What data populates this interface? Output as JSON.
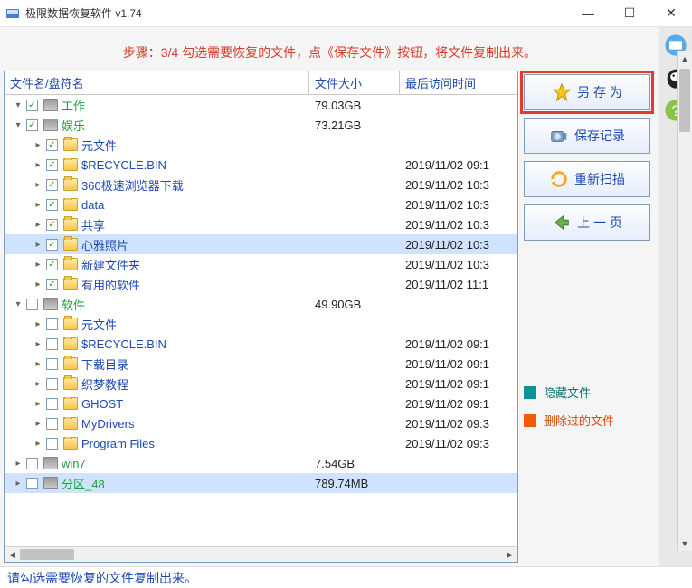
{
  "window": {
    "title": "极限数据恢复软件 v1.74"
  },
  "step_instruction": "步骤：3/4 勾选需要恢复的文件，点《保存文件》按钮，将文件复制出来。",
  "columns": {
    "name": "文件名/盘符名",
    "size": "文件大小",
    "time": "最后访问时间"
  },
  "rows": [
    {
      "depth": 0,
      "expander": "expanded",
      "checked": true,
      "icon": "drive",
      "label": "工作",
      "label_style": "green",
      "size": "79.03GB",
      "time": ""
    },
    {
      "depth": 0,
      "expander": "expanded",
      "checked": true,
      "icon": "drive",
      "label": "娱乐",
      "label_style": "green",
      "size": "73.21GB",
      "time": ""
    },
    {
      "depth": 1,
      "expander": "collapsed",
      "checked": true,
      "icon": "folder",
      "label": "元文件",
      "label_style": "blue",
      "size": "",
      "time": ""
    },
    {
      "depth": 1,
      "expander": "collapsed",
      "checked": true,
      "icon": "folder",
      "label": "$RECYCLE.BIN",
      "label_style": "blue",
      "size": "",
      "time": "2019/11/02 09:1"
    },
    {
      "depth": 1,
      "expander": "collapsed",
      "checked": true,
      "icon": "folder",
      "label": "360极速浏览器下载",
      "label_style": "blue",
      "size": "",
      "time": "2019/11/02 10:3"
    },
    {
      "depth": 1,
      "expander": "collapsed",
      "checked": true,
      "icon": "folder",
      "label": "data",
      "label_style": "blue",
      "size": "",
      "time": "2019/11/02 10:3"
    },
    {
      "depth": 1,
      "expander": "collapsed",
      "checked": true,
      "icon": "folder",
      "label": "共享",
      "label_style": "blue",
      "size": "",
      "time": "2019/11/02 10:3"
    },
    {
      "depth": 1,
      "expander": "collapsed",
      "checked": true,
      "icon": "folder",
      "label": "心雅照片",
      "label_style": "blue",
      "size": "",
      "time": "2019/11/02 10:3",
      "selected": true
    },
    {
      "depth": 1,
      "expander": "collapsed",
      "checked": true,
      "icon": "folder",
      "label": "新建文件夹",
      "label_style": "blue",
      "size": "",
      "time": "2019/11/02 10:3"
    },
    {
      "depth": 1,
      "expander": "collapsed",
      "checked": true,
      "icon": "folder",
      "label": "有用的软件",
      "label_style": "blue",
      "size": "",
      "time": "2019/11/02 11:1"
    },
    {
      "depth": 0,
      "expander": "expanded",
      "checked": false,
      "icon": "drive",
      "label": "软件",
      "label_style": "green",
      "size": "49.90GB",
      "time": ""
    },
    {
      "depth": 1,
      "expander": "collapsed",
      "checked": false,
      "icon": "folder",
      "label": "元文件",
      "label_style": "blue",
      "size": "",
      "time": ""
    },
    {
      "depth": 1,
      "expander": "collapsed",
      "checked": false,
      "icon": "folder",
      "label": "$RECYCLE.BIN",
      "label_style": "blue",
      "size": "",
      "time": "2019/11/02 09:1"
    },
    {
      "depth": 1,
      "expander": "collapsed",
      "checked": false,
      "icon": "folder",
      "label": "下载目录",
      "label_style": "blue",
      "size": "",
      "time": "2019/11/02 09:1"
    },
    {
      "depth": 1,
      "expander": "collapsed",
      "checked": false,
      "icon": "folder",
      "label": "织梦教程",
      "label_style": "blue",
      "size": "",
      "time": "2019/11/02 09:1"
    },
    {
      "depth": 1,
      "expander": "collapsed",
      "checked": false,
      "icon": "folder",
      "label": "GHOST",
      "label_style": "blue",
      "size": "",
      "time": "2019/11/02 09:1"
    },
    {
      "depth": 1,
      "expander": "collapsed",
      "checked": false,
      "icon": "folder",
      "label": "MyDrivers",
      "label_style": "blue",
      "size": "",
      "time": "2019/11/02 09:3"
    },
    {
      "depth": 1,
      "expander": "collapsed",
      "checked": false,
      "icon": "folder",
      "label": "Program Files",
      "label_style": "blue",
      "size": "",
      "time": "2019/11/02 09:3"
    },
    {
      "depth": 0,
      "expander": "collapsed",
      "checked": false,
      "icon": "drive",
      "label": "win7",
      "label_style": "green",
      "size": "7.54GB",
      "time": ""
    },
    {
      "depth": 0,
      "expander": "collapsed",
      "checked": false,
      "icon": "drive",
      "label": "分区_48",
      "label_style": "green",
      "size": "789.74MB",
      "time": "",
      "selected": true
    }
  ],
  "buttons": {
    "save_as": "另 存 为",
    "save_log": "保存记录",
    "rescan": "重新扫描",
    "prev": "上 一 页"
  },
  "legend": {
    "hidden": "隐藏文件",
    "deleted": "删除过的文件"
  },
  "status": "请勾选需要恢复的文件复制出来。",
  "icons": {
    "app": "app-icon",
    "minimize": "—",
    "maximize": "☐",
    "close": "✕"
  }
}
